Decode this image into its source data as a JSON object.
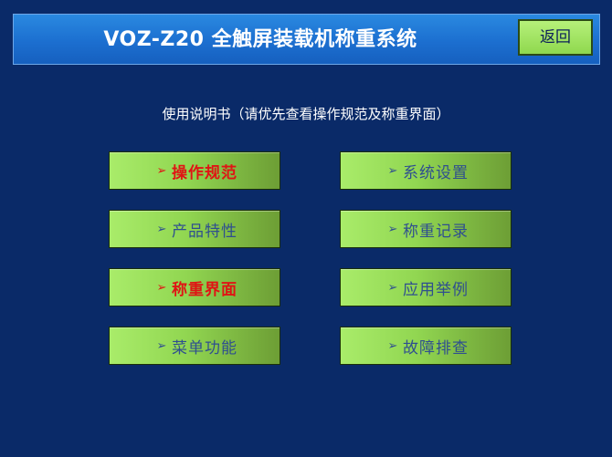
{
  "header": {
    "title": "VOZ-Z20 全触屏装载机称重系统",
    "back_label": "返回"
  },
  "subtitle": "使用说明书（请优先查看操作规范及称重界面）",
  "menu": {
    "chevron": "➢",
    "left": [
      {
        "label": "操作规范",
        "highlighted": true
      },
      {
        "label": "产品特性",
        "highlighted": false
      },
      {
        "label": "称重界面",
        "highlighted": true
      },
      {
        "label": "菜单功能",
        "highlighted": false
      }
    ],
    "right": [
      {
        "label": "系统设置",
        "highlighted": false
      },
      {
        "label": "称重记录",
        "highlighted": false
      },
      {
        "label": "应用举例",
        "highlighted": false
      },
      {
        "label": "故障排查",
        "highlighted": false
      }
    ]
  },
  "colors": {
    "background": "#0a2a68",
    "title_bar": "#1c6fd0",
    "button_green": "#91d651",
    "highlight_text": "#e01414",
    "normal_text": "#2f4f8f"
  }
}
